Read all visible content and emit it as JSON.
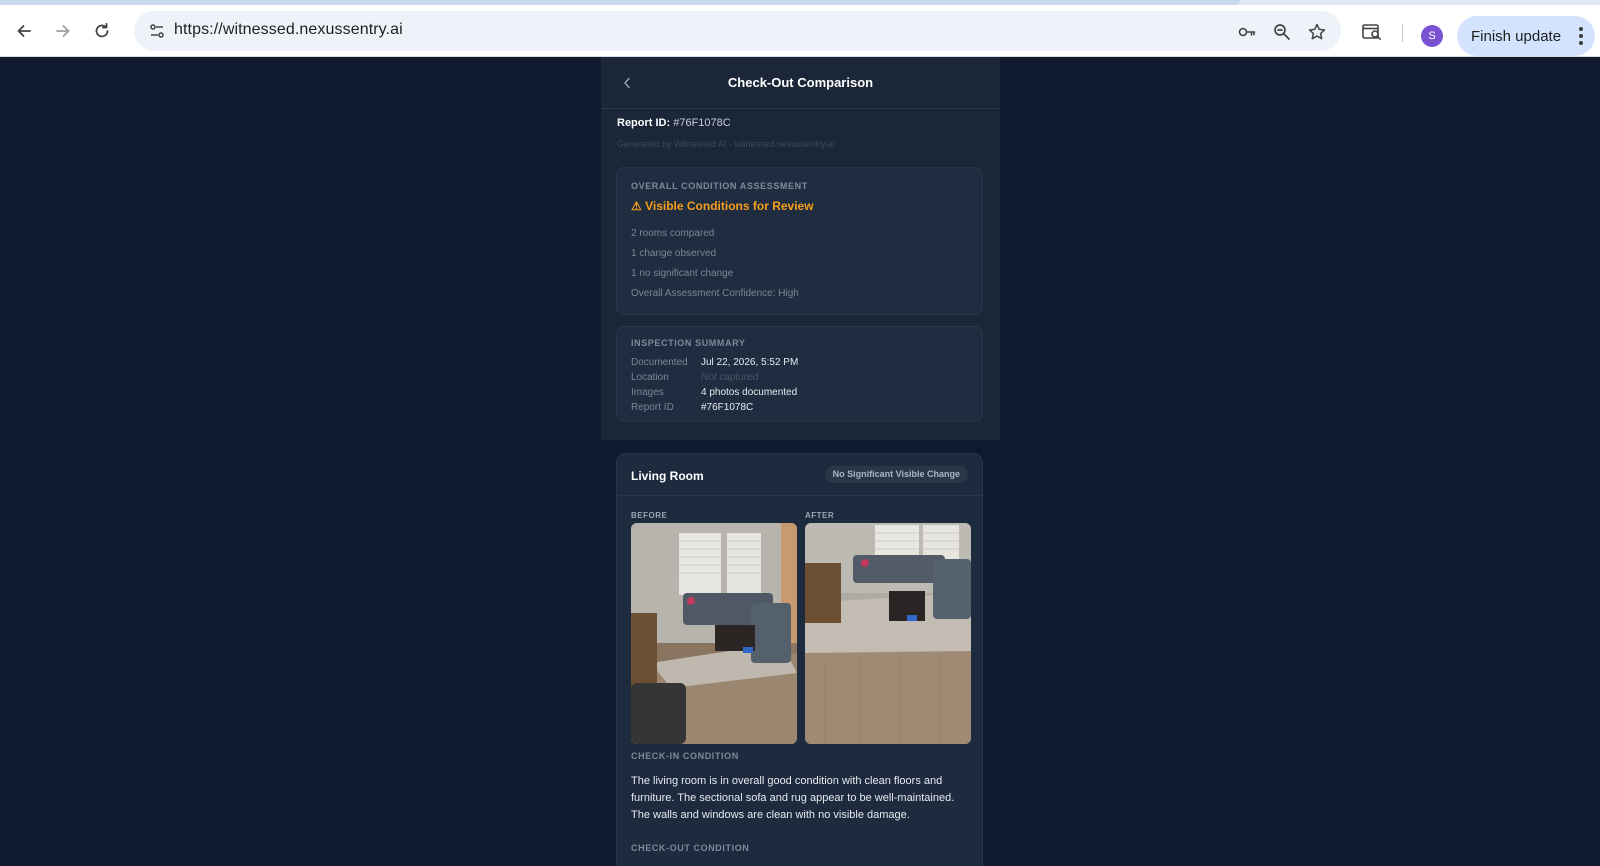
{
  "browser": {
    "url": "https://witnessed.nexussentry.ai",
    "finish_update_label": "Finish update",
    "avatar_initial": "S",
    "accent": "#d3e3fd"
  },
  "page": {
    "title": "Check-Out Comparison",
    "report_label": "Report ID:",
    "report_id": "#76F1078C",
    "generated": "Generated by Witnessed AI · witnessed.nexussentry.ai"
  },
  "assessment": {
    "label": "OVERALL CONDITION ASSESSMENT",
    "status": "⚠ Visible Conditions for Review",
    "status_color": "#f59f1b",
    "stats": [
      "2 rooms compared",
      "1 change observed",
      "1 no significant change",
      "Overall Assessment Confidence: High"
    ]
  },
  "summary": {
    "label": "INSPECTION SUMMARY",
    "rows": [
      {
        "key": "Documented",
        "value": "Jul 22, 2026, 5:52 PM"
      },
      {
        "key": "Location",
        "value": "Not captured"
      },
      {
        "key": "Images",
        "value": "4 photos documented"
      },
      {
        "key": "Report ID",
        "value": "#76F1078C"
      }
    ]
  },
  "room": {
    "name": "Living Room",
    "badge": "No Significant Visible Change",
    "before_label": "BEFORE",
    "after_label": "AFTER",
    "checkin_label": "CHECK-IN CONDITION",
    "checkin_text": "The living room is in overall good condition with clean floors and furniture. The sectional sofa and rug appear to be well-maintained. The walls and windows are clean with no visible damage.",
    "checkout_label": "CHECK-OUT CONDITION"
  }
}
